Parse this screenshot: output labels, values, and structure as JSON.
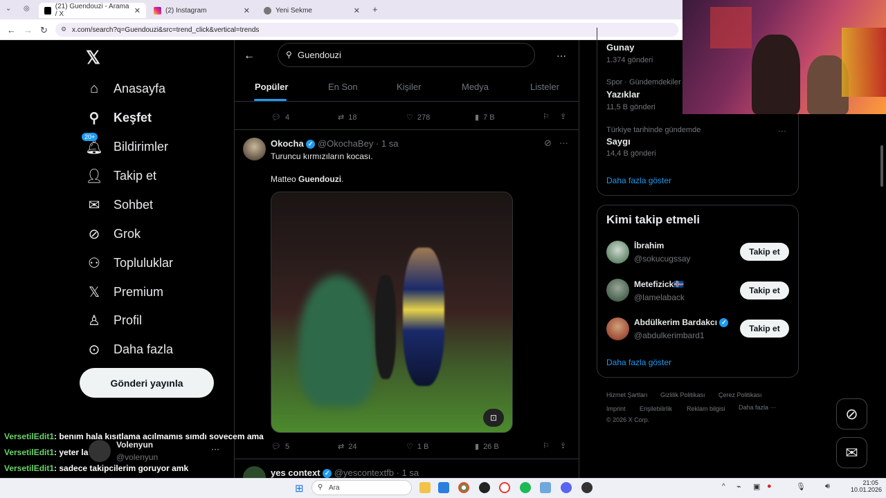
{
  "browser": {
    "tabs": [
      {
        "title": "(21) Guendouzi - Arama / X"
      },
      {
        "title": "(2) Instagram"
      },
      {
        "title": "Yeni Sekme"
      }
    ],
    "url": "x.com/search?q=Guendouzi&src=trend_click&vertical=trends"
  },
  "sidebar": {
    "items": [
      {
        "label": "Anasayfa",
        "icon": "home-icon"
      },
      {
        "label": "Keşfet",
        "icon": "search-icon"
      },
      {
        "label": "Bildirimler",
        "icon": "bell-icon",
        "badge": "20+"
      },
      {
        "label": "Takip et",
        "icon": "follow-icon"
      },
      {
        "label": "Sohbet",
        "icon": "mail-icon"
      },
      {
        "label": "Grok",
        "icon": "grok-icon"
      },
      {
        "label": "Topluluklar",
        "icon": "communities-icon"
      },
      {
        "label": "Premium",
        "icon": "x-icon"
      },
      {
        "label": "Profil",
        "icon": "profile-icon"
      },
      {
        "label": "Daha fazla",
        "icon": "more-icon"
      }
    ],
    "post_button": "Gönderi yayınla",
    "account": {
      "name": "Volenyun",
      "handle": "@volenyun"
    }
  },
  "search": {
    "query": "Guendouzi"
  },
  "tabs": [
    "Popüler",
    "En Son",
    "Kişiler",
    "Medya",
    "Listeler"
  ],
  "prev_post_actions": {
    "replies": "4",
    "reposts": "18",
    "likes": "278",
    "views": "7 B"
  },
  "post": {
    "author": "Okocha",
    "handle": "@OkochaBey",
    "time": "· 1 sa",
    "line1": "Turuncu kırmızıların kocası.",
    "line2_prefix": "Matteo ",
    "line2_bold": "Guendouzi",
    "line2_suffix": ".",
    "actions": {
      "replies": "5",
      "reposts": "24",
      "likes": "1 B",
      "views": "26 B"
    }
  },
  "next_post": {
    "author": "yes context",
    "handle": "@yescontextfb",
    "time": "· 1 sa"
  },
  "trends": [
    {
      "category": "",
      "title": "Gunay",
      "count": "1.374 gönderi"
    },
    {
      "category": "Spor · Gündemdekiler",
      "title": "Yazıklar",
      "count": "11,5 B gönderi"
    },
    {
      "category": "Türkiye tarihinde gündemde",
      "title": "Saygı",
      "count": "14,4 B gönderi"
    }
  ],
  "show_more": "Daha fazla göster",
  "who_to_follow": {
    "title": "Kimi takip etmeli",
    "users": [
      {
        "name": "İbrahim",
        "handle": "@sokucugssay",
        "button": "Takip et"
      },
      {
        "name": "Metefizick🇮🇸",
        "handle": "@lamelaback",
        "button": "Takip et"
      },
      {
        "name": "Abdülkerim Bardakcı",
        "handle": "@abdulkerimbard1",
        "button": "Takip et"
      }
    ],
    "show_more": "Daha fazla göster"
  },
  "footer": [
    "Hizmet Şartları",
    "Gizlilik Politikası",
    "Çerez Politikası",
    "Imprint",
    "Erişilebilirlik",
    "Reklam bilgisi",
    "Daha fazla ···",
    "© 2026 X Corp."
  ],
  "chat": [
    {
      "user": "VersetilEdit1",
      "text": ": benım hala kısıtlama acılmamıs sımdı sovecem ama"
    },
    {
      "user": "VersetilEdit1",
      "text": ": yeter la"
    },
    {
      "user": "VersetilEdit1",
      "text": ": sadece takipcilerim goruyor amk"
    }
  ],
  "taskbar": {
    "search_placeholder": "Ara",
    "time": "21:05",
    "date": "10.01.2026"
  },
  "colors": {
    "accent": "#1d9bf0",
    "bg": "#000000",
    "border": "#2f3336"
  }
}
